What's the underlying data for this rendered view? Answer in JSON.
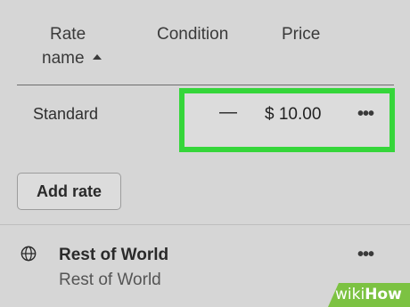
{
  "table": {
    "headers": {
      "rate_name_line1": "Rate",
      "rate_name_line2": "name",
      "condition": "Condition",
      "price": "Price"
    },
    "rows": [
      {
        "name": "Standard",
        "condition": "—",
        "price": "$ 10.00"
      }
    ]
  },
  "add_rate_label": "Add rate",
  "zone": {
    "title": "Rest of World",
    "subtitle": "Rest of World"
  },
  "icons": {
    "sort": "sort-ascending-icon",
    "more": "more-horizontal-icon",
    "globe": "globe-icon"
  },
  "colors": {
    "highlight": "#35d63a",
    "watermark": "#7cc242"
  },
  "watermark": {
    "part1": "wiki",
    "part2": "How"
  }
}
